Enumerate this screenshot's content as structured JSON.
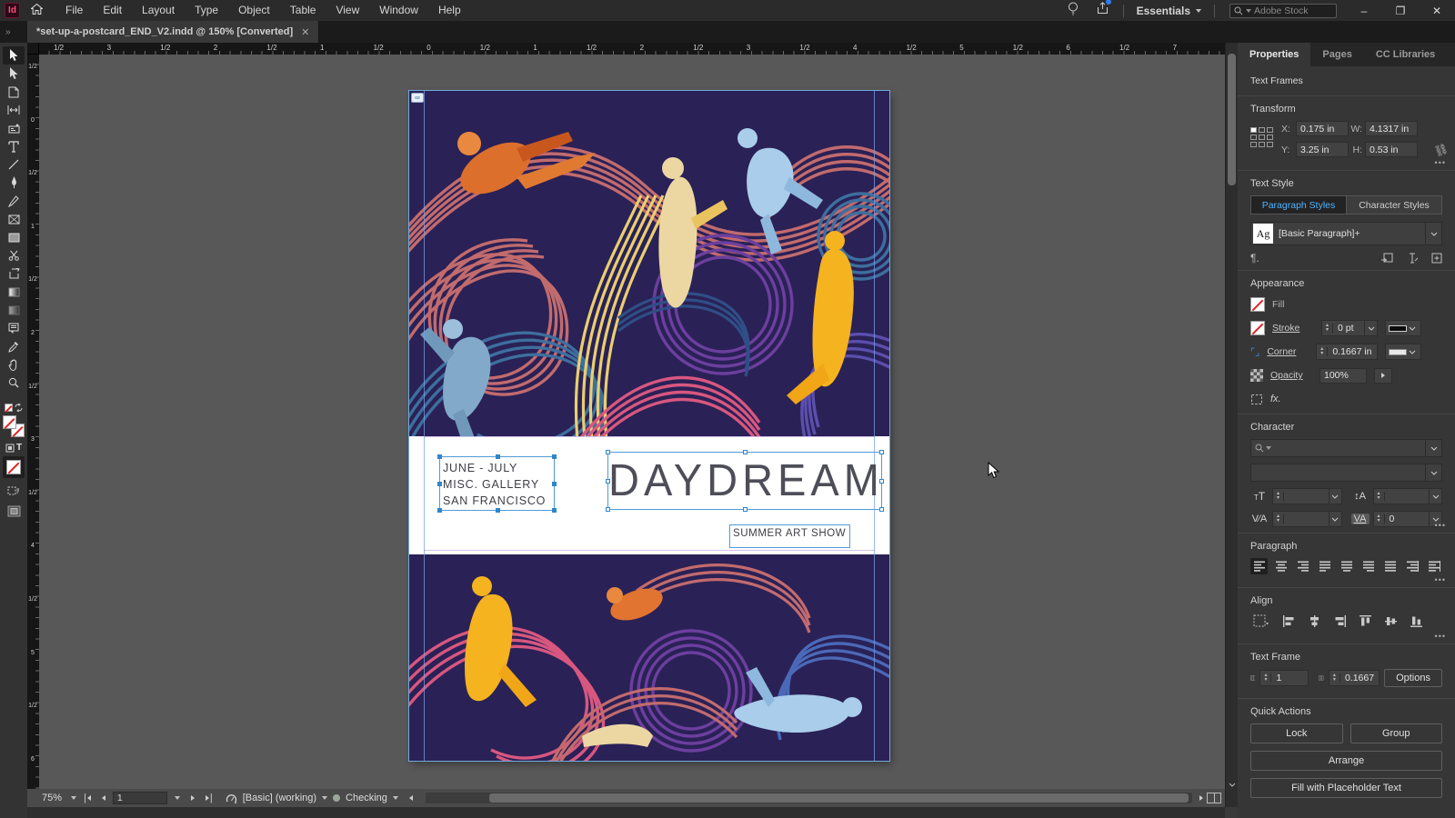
{
  "colors": {
    "selection_accent": "#4f9bd8",
    "paragraph_styles_active": "#4fb3ff",
    "artwork_background": "#2a2156",
    "artwork_salmon": "#c26b6d",
    "artwork_blue": "#3d6f9e",
    "artwork_purple": "#6c3f9e",
    "artwork_pink": "#d8577f",
    "artwork_yellow": "#e9cf6f",
    "panel_background": "#363636"
  },
  "app_bar": {
    "logo": "Id",
    "menus": [
      "File",
      "Edit",
      "Layout",
      "Type",
      "Object",
      "Table",
      "View",
      "Window",
      "Help"
    ],
    "workspace_label": "Essentials",
    "search_placeholder": "Adobe Stock",
    "window_minimize": "–",
    "window_restore": "❐",
    "window_close": "✕"
  },
  "tab_bar": {
    "overflow_chevrons": "»",
    "doc_title": "*set-up-a-postcard_END_V2.indd @ 150% [Converted]",
    "close": "✕"
  },
  "rulers": {
    "horizontal": [
      "1/2",
      "3",
      "1/2",
      "2",
      "1/2",
      "1",
      "1/2",
      "0",
      "1/2",
      "1",
      "1/2",
      "2",
      "1/2",
      "3",
      "1/2",
      "4",
      "1/2",
      "5",
      "1/2",
      "6",
      "1/2",
      "7",
      "1/2"
    ],
    "vertical": [
      "1/2",
      "0",
      "1/2",
      "1",
      "1/2",
      "2",
      "1/2",
      "3",
      "1/2",
      "4",
      "1/2",
      "5",
      "1/2",
      "6",
      "1/2"
    ]
  },
  "artboard": {
    "info_line_1": "JUNE - JULY",
    "info_line_2": "MISC. GALLERY",
    "info_line_3": "SAN FRANCISCO",
    "title": "DAYDREAM",
    "banner": "SUMMER ART SHOW",
    "link_badge": "∞"
  },
  "panel": {
    "tabs": [
      "Properties",
      "Pages",
      "CC Libraries"
    ],
    "selection_type": "Text Frames",
    "transform": {
      "heading": "Transform",
      "x_label": "X:",
      "x_value": "0.175 in",
      "y_label": "Y:",
      "y_value": "3.25 in",
      "w_label": "W:",
      "w_value": "4.1317 in",
      "h_label": "H:",
      "h_value": "0.53 in",
      "more": "•••"
    },
    "text_style": {
      "heading": "Text Style",
      "tab_paragraph": "Paragraph Styles",
      "tab_character": "Character Styles",
      "sample": "Ag",
      "style_name": "[Basic Paragraph]+",
      "pilcrow": "¶."
    },
    "appearance": {
      "heading": "Appearance",
      "fill_label": "Fill",
      "stroke_label": "Stroke",
      "stroke_weight": "0 pt",
      "corner_label": "Corner",
      "corner_radius": "0.1667 in",
      "opacity_label": "Opacity",
      "opacity_value": "100%",
      "fx_label": "fx."
    },
    "character": {
      "heading": "Character",
      "tracking_value": "0",
      "more": "•••"
    },
    "paragraph": {
      "heading": "Paragraph",
      "more": "•••"
    },
    "align": {
      "heading": "Align",
      "more": "•••"
    },
    "text_frame": {
      "heading": "Text Frame",
      "columns_value": "1",
      "gutter_value": "0.1667",
      "options_label": "Options"
    },
    "quick_actions": {
      "heading": "Quick Actions",
      "lock": "Lock",
      "group": "Group",
      "arrange": "Arrange",
      "fill_placeholder": "Fill with Placeholder Text"
    }
  },
  "status_bar": {
    "zoom_level": "75%",
    "page_number": "1",
    "preflight_profile": "[Basic] (working)",
    "preflight_status": "Checking"
  }
}
